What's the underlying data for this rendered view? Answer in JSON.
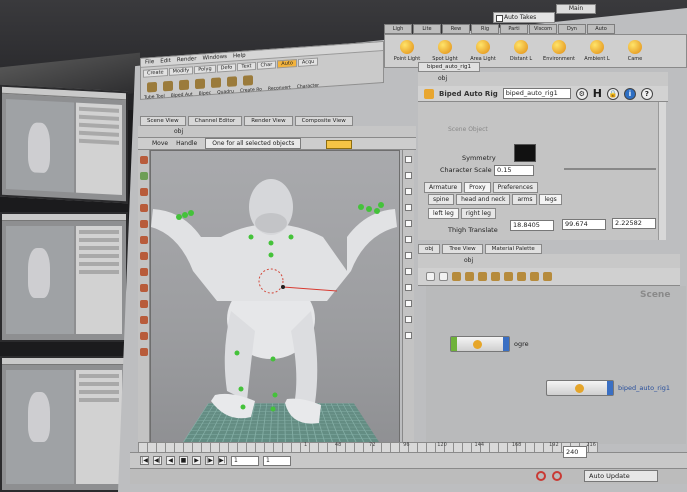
{
  "topbar": {
    "auto_takes": "Auto Takes",
    "main": "Main",
    "shelf_tabs": [
      "Ligh",
      "Lite",
      "Rew",
      "Rig",
      "Parti",
      "Viscom",
      "Dyn",
      "Auto"
    ],
    "tools": [
      "Point Light",
      "Spot Light",
      "Area Light",
      "Distant L",
      "Environment",
      "Ambient L",
      "Came"
    ]
  },
  "left_shelf": {
    "menu": [
      "File",
      "Edit",
      "Render",
      "Windows",
      "Help"
    ],
    "tabs": [
      "Create",
      "Modify",
      "Polyg",
      "Defo",
      "Text",
      "Char",
      "Auto",
      "Acqu"
    ],
    "tools": [
      "Tube Tool",
      "Biped Aut",
      "Bipec",
      "Quadru",
      "Create Ro",
      "Reconvert",
      "Character"
    ]
  },
  "scene_view": {
    "tabs": [
      "Scene View",
      "Channel Editor",
      "Render View",
      "Composite View"
    ],
    "path": "obj",
    "tool_label": "Move",
    "handle_label": "Handle",
    "selection_filter": "One for all selected objects"
  },
  "parameters": {
    "tab": "biped_auto_rig1",
    "path": "obj",
    "node_type": "Biped Auto Rig",
    "node_name": "biped_auto_rig1",
    "h_label": "H",
    "scene_object_label": "Scene Object",
    "symmetry_label": "Symmetry",
    "character_scale_label": "Character Scale",
    "character_scale_value": "0.15",
    "tabs_main": [
      "Armature",
      "Proxy",
      "Preferences"
    ],
    "tabs_parts": [
      "spine",
      "head and neck",
      "arms",
      "legs"
    ],
    "tabs_side": [
      "left leg",
      "right leg"
    ],
    "thigh_translate_label": "Thigh Translate",
    "thigh_translate": [
      "18.8405",
      "99.674",
      "2.22582"
    ]
  },
  "network": {
    "tabs": [
      "obj",
      "Tree View",
      "Material Palette"
    ],
    "path": "obj",
    "watermark": "Scene",
    "nodes": [
      {
        "label": "ogre"
      },
      {
        "label": "biped_auto_rig1"
      }
    ]
  },
  "timeline": {
    "ticks": [
      "1",
      "48",
      "72",
      "96",
      "120",
      "144",
      "168",
      "192",
      "216"
    ],
    "current_frame": "1",
    "start_frame": "1",
    "end_frame": "240",
    "auto_update": "Auto Update"
  }
}
